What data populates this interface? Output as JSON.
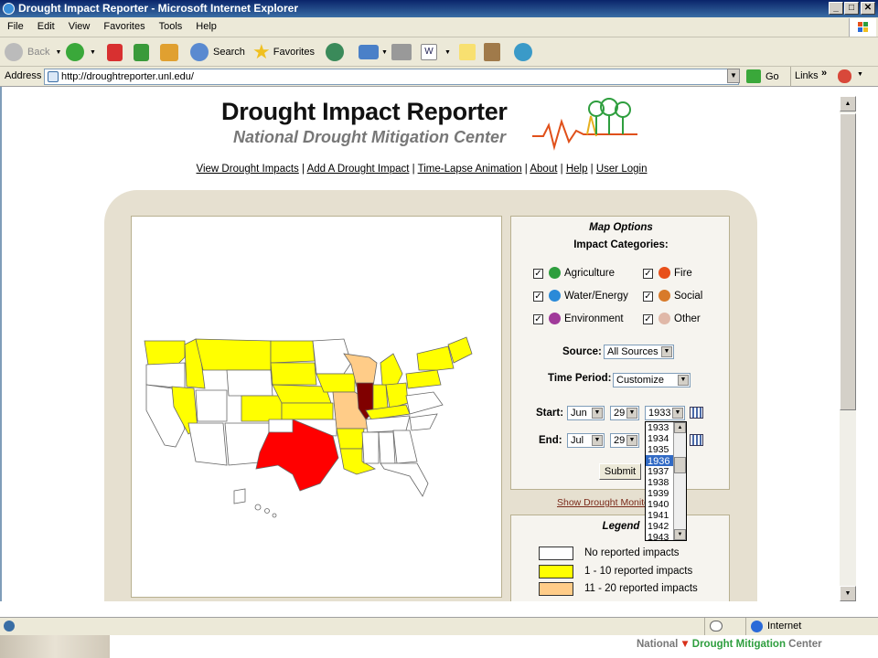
{
  "window": {
    "title": "Drought Impact Reporter - Microsoft Internet Explorer"
  },
  "menu": [
    "File",
    "Edit",
    "View",
    "Favorites",
    "Tools",
    "Help"
  ],
  "toolbar": {
    "back": "Back",
    "search": "Search",
    "favorites": "Favorites"
  },
  "address": {
    "label": "Address",
    "url": "http://droughtreporter.unl.edu/",
    "go": "Go",
    "links": "Links"
  },
  "header": {
    "title": "Drought Impact Reporter",
    "subtitle": "National Drought Mitigation Center"
  },
  "nav": [
    "View Drought Impacts",
    "Add A Drought Impact",
    "Time-Lapse Animation",
    "About",
    "Help",
    "User Login"
  ],
  "map_options": {
    "title": "Map Options",
    "categories_title": "Impact Categories:",
    "categories": [
      {
        "label": "Agriculture",
        "checked": true,
        "color": "#2e9e3e"
      },
      {
        "label": "Fire",
        "checked": true,
        "color": "#e8501a"
      },
      {
        "label": "Water/Energy",
        "checked": true,
        "color": "#2a8ad8"
      },
      {
        "label": "Social",
        "checked": true,
        "color": "#d87a2a"
      },
      {
        "label": "Environment",
        "checked": true,
        "color": "#a03a9a"
      },
      {
        "label": "Other",
        "checked": true,
        "color": "#e0b8a8"
      }
    ],
    "source_label": "Source:",
    "source_value": "All Sources",
    "period_label": "Time Period:",
    "period_value": "Customize",
    "start_label": "Start:",
    "start": {
      "month": "Jun",
      "day": "29",
      "year": "1933"
    },
    "end_label": "End:",
    "end": {
      "month": "Jul",
      "day": "29"
    },
    "submit": "Submit",
    "year_options": [
      "1933",
      "1934",
      "1935",
      "1936",
      "1937",
      "1938",
      "1939",
      "1940",
      "1941",
      "1942",
      "1943"
    ],
    "year_highlighted": "1936"
  },
  "monitor_link": "Show Drought Monitor",
  "legend": {
    "title": "Legend",
    "items": [
      {
        "label": "No reported impacts",
        "color": "#ffffff"
      },
      {
        "label": "1 - 10 reported impacts",
        "color": "#ffff00"
      },
      {
        "label": "11 - 20 reported impacts",
        "color": "#ffcc88"
      }
    ]
  },
  "status": {
    "zone": "Internet"
  },
  "footer": {
    "org_a": "National",
    "org_b": "Drought Mitigation",
    "org_c": "Center"
  }
}
